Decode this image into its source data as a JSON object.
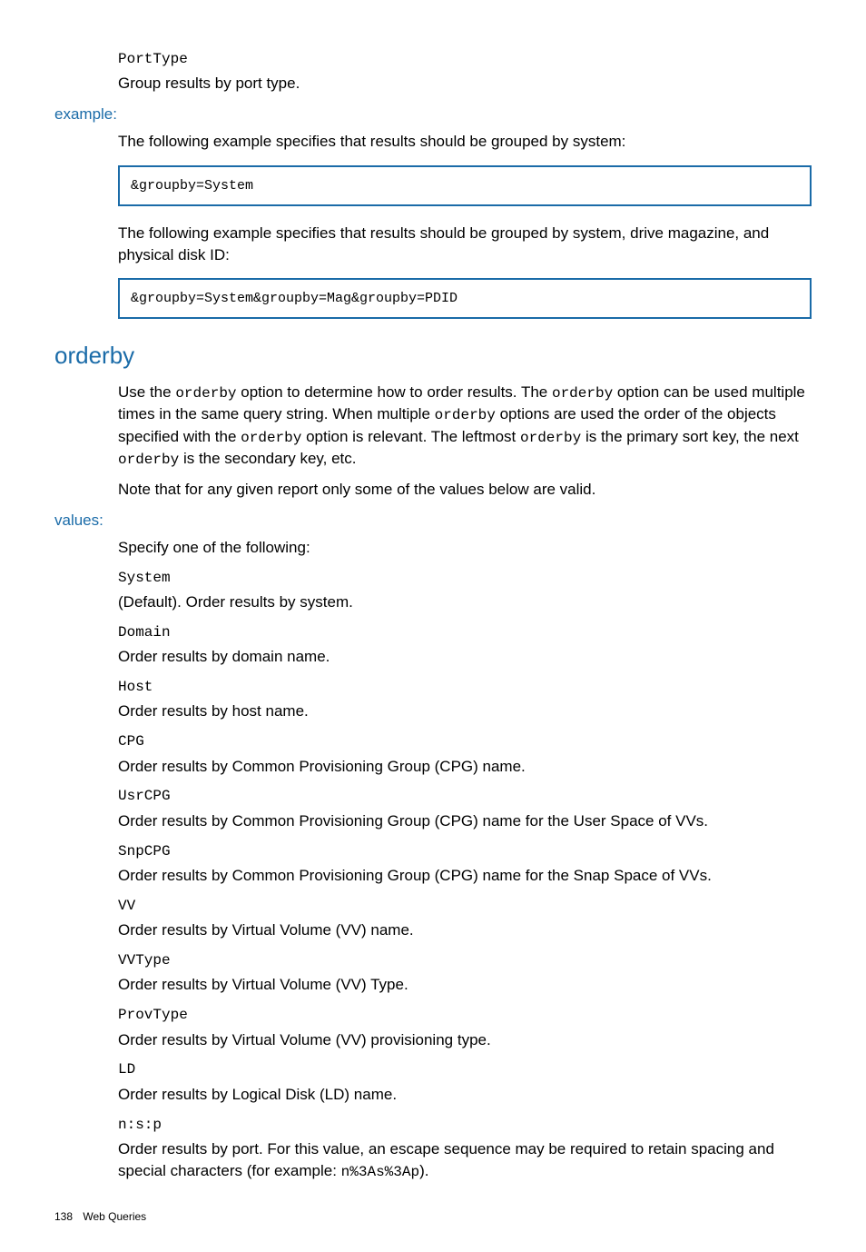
{
  "portType": {
    "code": "PortType",
    "desc": "Group results by port type."
  },
  "exampleSection": {
    "label": "example:",
    "para1": "The following example specifies that results should be grouped by system:",
    "code1": "&groupby=System",
    "para2": "The following example specifies that results should be grouped by system, drive magazine, and physical disk ID:",
    "code2": "&groupby=System&groupby=Mag&groupby=PDID"
  },
  "orderbySection": {
    "heading": "orderby",
    "para1_a": "Use the ",
    "para1_code1": "orderby",
    "para1_b": " option to determine how to order results. The ",
    "para1_code2": "orderby",
    "para1_c": " option can be used multiple times in the same query string. When multiple ",
    "para1_code3": "orderby",
    "para1_d": " options are used the order of the objects specified with the ",
    "para1_code4": "orderby",
    "para1_e": " option is relevant. The leftmost ",
    "para1_code5": "orderby",
    "para1_f": " is the primary sort key, the next ",
    "para1_code6": "orderby",
    "para1_g": " is the secondary key, etc.",
    "para2": "Note that for any given report only some of the values below are valid."
  },
  "valuesSection": {
    "label": "values:",
    "intro": "Specify one of the following:",
    "items": [
      {
        "term": "System",
        "desc": "(Default). Order results by system."
      },
      {
        "term": "Domain",
        "desc": "Order results by domain name."
      },
      {
        "term": "Host",
        "desc": "Order results by host name."
      },
      {
        "term": "CPG",
        "desc": "Order results by Common Provisioning Group (CPG) name."
      },
      {
        "term": "UsrCPG",
        "desc": "Order results by Common Provisioning Group (CPG) name for the User Space of VVs."
      },
      {
        "term": "SnpCPG",
        "desc": "Order results by Common Provisioning Group (CPG) name for the Snap Space of VVs."
      },
      {
        "term": "VV",
        "desc": "Order results by Virtual Volume (VV) name."
      },
      {
        "term": "VVType",
        "desc": "Order results by Virtual Volume (VV) Type."
      },
      {
        "term": "ProvType",
        "desc": "Order results by Virtual Volume (VV) provisioning type."
      },
      {
        "term": "LD",
        "desc": "Order results by Logical Disk (LD) name."
      }
    ],
    "nsp": {
      "term": "n:s:p",
      "desc_a": "Order results by port. For this value, an escape sequence may be required to retain spacing and special characters (for example: ",
      "desc_code": "n%3As%3Ap",
      "desc_b": ")."
    }
  },
  "footer": {
    "pageNum": "138",
    "section": "Web Queries"
  }
}
